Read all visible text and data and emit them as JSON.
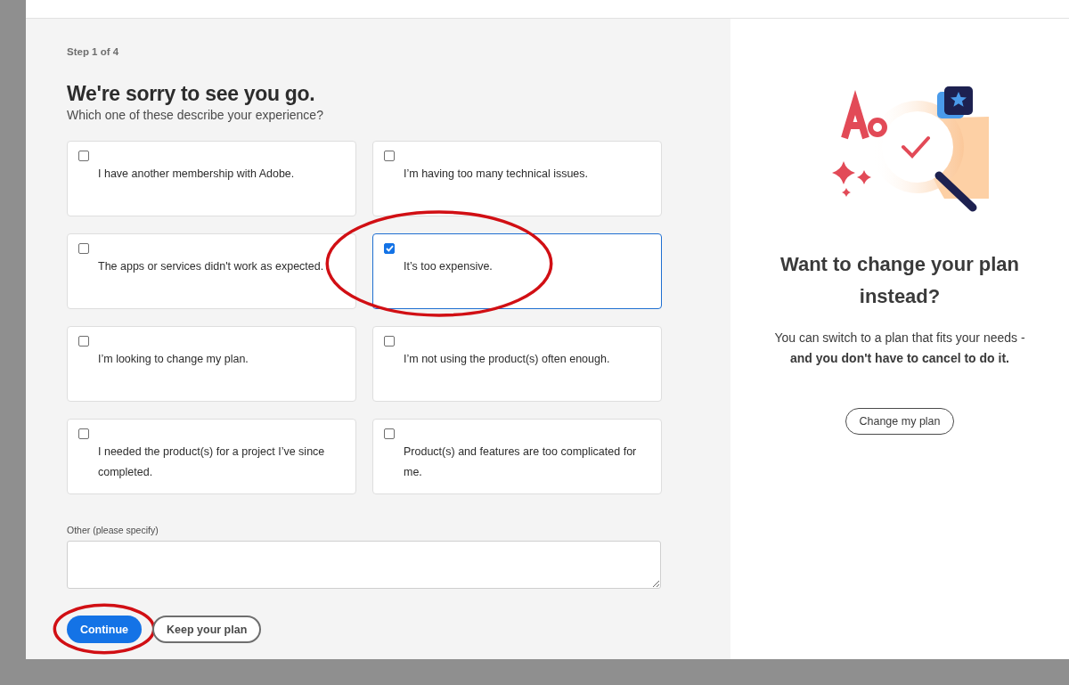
{
  "step": "Step 1 of 4",
  "title": "We're sorry to see you go.",
  "subtitle": "Which one of these describe your experience?",
  "options": [
    {
      "label": "I have another membership with Adobe.",
      "checked": false,
      "circled": false
    },
    {
      "label": "I’m having too many technical issues.",
      "checked": false,
      "circled": false
    },
    {
      "label": "The apps or services didn't work as expected.",
      "checked": false,
      "circled": false
    },
    {
      "label": "It’s too expensive.",
      "checked": true,
      "circled": true
    },
    {
      "label": "I’m looking to change my plan.",
      "checked": false,
      "circled": false
    },
    {
      "label": "I’m not using the product(s) often enough.",
      "checked": false,
      "circled": false
    },
    {
      "label": "I needed the product(s) for a project I’ve since completed.",
      "checked": false,
      "circled": false
    },
    {
      "label": "Product(s) and features are too complicated for me.",
      "checked": false,
      "circled": false
    }
  ],
  "other": {
    "label": "Other (please specify)"
  },
  "buttons": [
    {
      "label": "Continue",
      "kind": "primary",
      "circled": true
    },
    {
      "label": "Keep your plan",
      "kind": "secondary",
      "circled": false
    }
  ],
  "side": {
    "title": "Want to change your plan instead?",
    "text": "You can switch to a plan that fits your needs - **and you don't have to cancel to do it.**",
    "button": "Change my plan"
  }
}
